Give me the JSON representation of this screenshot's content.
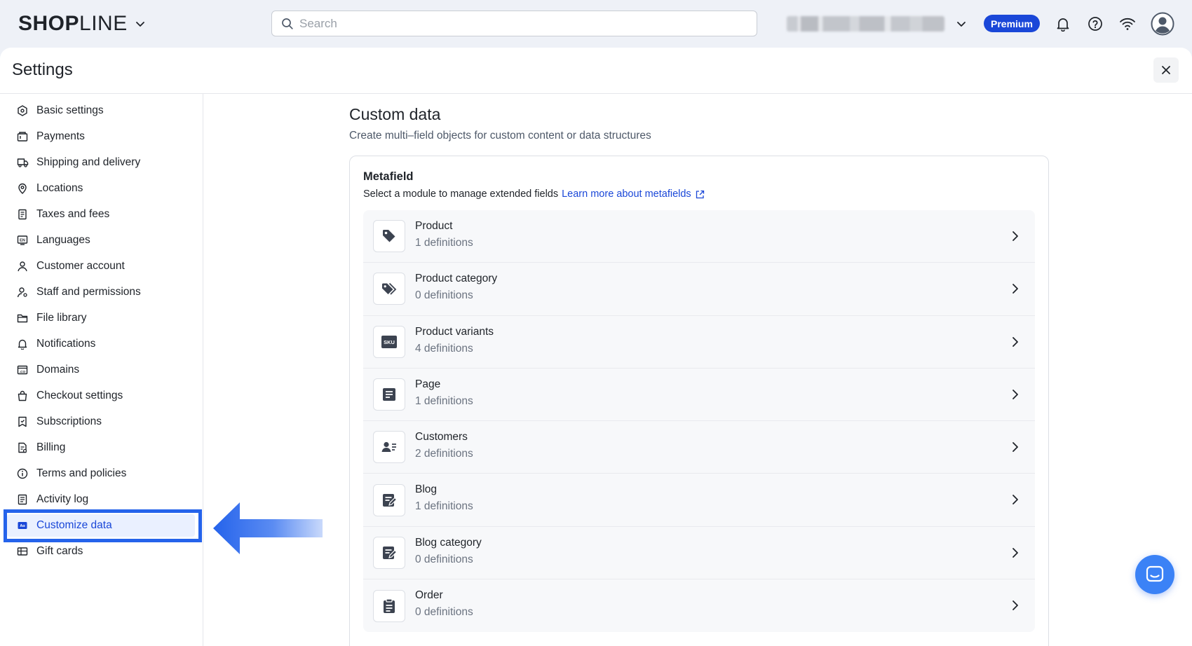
{
  "header": {
    "logo_bold": "SHOP",
    "logo_light": "LINE",
    "search_placeholder": "Search",
    "plan_badge": "Premium"
  },
  "settings": {
    "title": "Settings"
  },
  "sidebar": {
    "items": [
      {
        "label": "Basic settings",
        "icon": "settings-hex-icon"
      },
      {
        "label": "Payments",
        "icon": "wallet-icon"
      },
      {
        "label": "Shipping and delivery",
        "icon": "truck-icon"
      },
      {
        "label": "Locations",
        "icon": "location-pin-icon"
      },
      {
        "label": "Taxes and fees",
        "icon": "receipt-icon"
      },
      {
        "label": "Languages",
        "icon": "language-icon"
      },
      {
        "label": "Customer account",
        "icon": "user-icon"
      },
      {
        "label": "Staff and permissions",
        "icon": "staff-icon"
      },
      {
        "label": "File library",
        "icon": "folder-icon"
      },
      {
        "label": "Notifications",
        "icon": "bell-icon"
      },
      {
        "label": "Domains",
        "icon": "domain-icon"
      },
      {
        "label": "Checkout settings",
        "icon": "bag-icon"
      },
      {
        "label": "Subscriptions",
        "icon": "subscription-icon"
      },
      {
        "label": "Billing",
        "icon": "bill-icon"
      },
      {
        "label": "Terms and policies",
        "icon": "info-icon"
      },
      {
        "label": "Activity log",
        "icon": "log-icon"
      },
      {
        "label": "Customize data",
        "icon": "custom-data-icon",
        "active": true
      },
      {
        "label": "Gift cards",
        "icon": "gift-card-icon"
      }
    ]
  },
  "content": {
    "title": "Custom data",
    "subtitle": "Create multi–field objects for custom content or data structures",
    "card": {
      "title": "Metafield",
      "subtitle": "Select a module to manage extended fields",
      "link": "Learn more about metafields",
      "rows": [
        {
          "name": "Product",
          "count": "1 definitions",
          "icon": "tag-icon"
        },
        {
          "name": "Product category",
          "count": "0 definitions",
          "icon": "tags-icon"
        },
        {
          "name": "Product variants",
          "count": "4 definitions",
          "icon": "sku-icon",
          "icon_text": "SKU"
        },
        {
          "name": "Page",
          "count": "1 definitions",
          "icon": "page-icon"
        },
        {
          "name": "Customers",
          "count": "2 definitions",
          "icon": "customer-card-icon"
        },
        {
          "name": "Blog",
          "count": "1 definitions",
          "icon": "blog-edit-icon"
        },
        {
          "name": "Blog category",
          "count": "0 definitions",
          "icon": "blog-edit-icon"
        },
        {
          "name": "Order",
          "count": "0 definitions",
          "icon": "clipboard-icon"
        }
      ]
    }
  },
  "colors": {
    "brand_blue": "#1a47d8",
    "highlight_blue": "#2563eb",
    "chat_blue": "#3b82f6"
  }
}
